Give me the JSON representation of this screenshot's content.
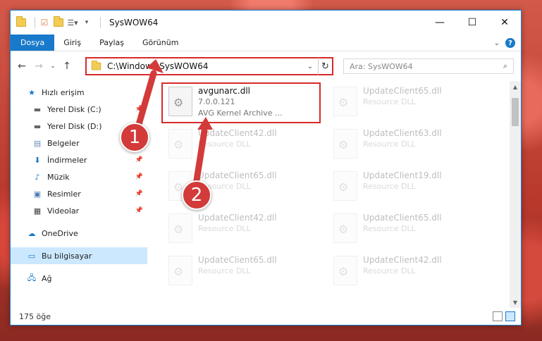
{
  "window": {
    "title": "SysWOW64",
    "controls": {
      "minimize": "—",
      "maximize": "☐",
      "close": "✕"
    }
  },
  "ribbon": {
    "tabs": [
      "Dosya",
      "Giriş",
      "Paylaş",
      "Görünüm"
    ],
    "help": "?"
  },
  "nav": {
    "address": "C:\\Windows\\SysWOW64",
    "search_placeholder": "Ara: SysWOW64"
  },
  "sidebar": {
    "quick_access": "Hızlı erişim",
    "quick_items": [
      {
        "label": "Yerel Disk (C:)",
        "icon": "drive-icon",
        "pinned": true
      },
      {
        "label": "Yerel Disk (D:)",
        "icon": "drive-icon",
        "pinned": false
      },
      {
        "label": "Belgeler",
        "icon": "documents-icon",
        "pinned": true
      },
      {
        "label": "İndirmeler",
        "icon": "downloads-icon",
        "pinned": true
      },
      {
        "label": "Müzik",
        "icon": "music-icon",
        "pinned": true
      },
      {
        "label": "Resimler",
        "icon": "pictures-icon",
        "pinned": true
      },
      {
        "label": "Videolar",
        "icon": "videos-icon",
        "pinned": true
      }
    ],
    "onedrive": "OneDrive",
    "this_pc": "Bu bilgisayar",
    "network": "Ağ"
  },
  "files": [
    {
      "name": "avgunarc.dll",
      "line2": "7.0.0.121",
      "line3": "AVG Kernel Archive ...",
      "highlighted": true
    },
    {
      "name": "UpdateClient65.dll",
      "line2": "Resource DLL"
    },
    {
      "name": "UpdateClient42.dll",
      "line2": "Resource DLL"
    },
    {
      "name": "UpdateClient63.dll",
      "line2": "Resource DLL"
    },
    {
      "name": "UpdateClient65.dll",
      "line2": "Resource DLL"
    },
    {
      "name": "UpdateClient19.dll",
      "line2": "Resource DLL"
    },
    {
      "name": "UpdateClient42.dll",
      "line2": "Resource DLL"
    },
    {
      "name": "UpdateClient65.dll",
      "line2": "Resource DLL"
    },
    {
      "name": "UpdateClient65.dll",
      "line2": "Resource DLL"
    },
    {
      "name": "UpdateClient42.dll",
      "line2": "Resource DLL"
    }
  ],
  "status": {
    "count": "175 öğe"
  },
  "markers": [
    "1",
    "2"
  ],
  "colors": {
    "accent": "#1979ca",
    "highlight": "#d62a2a",
    "marker": "#d33a3a"
  }
}
